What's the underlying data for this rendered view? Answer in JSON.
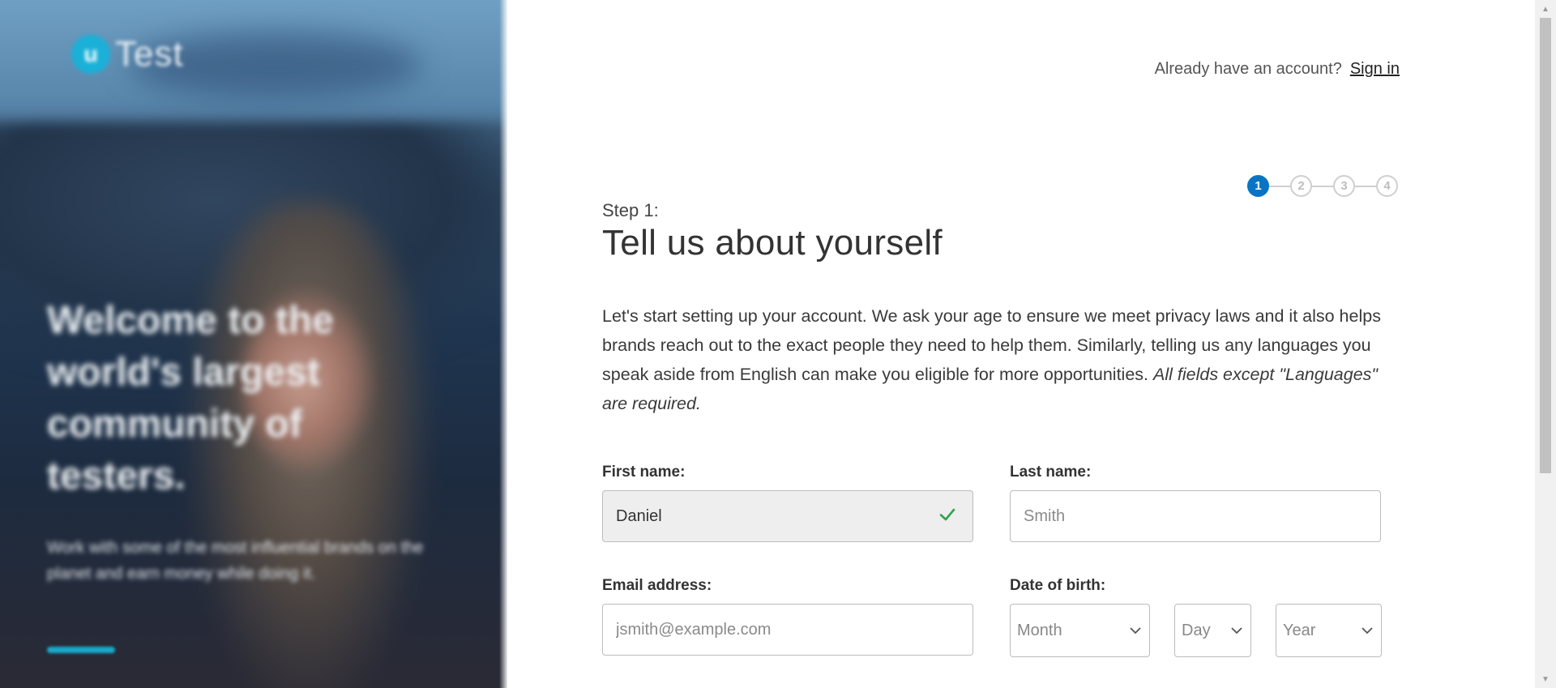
{
  "hero": {
    "logo_mark": "u",
    "logo_text": "Test",
    "headline": "Welcome to the world's largest community of testers.",
    "subcopy": "Work with some of the most influential brands on the planet and earn money while doing it."
  },
  "header": {
    "prompt": "Already have an account?",
    "signin_label": "Sign in"
  },
  "stepper": {
    "steps": [
      "1",
      "2",
      "3",
      "4"
    ],
    "active": 1
  },
  "form": {
    "step_label": "Step 1:",
    "title": "Tell us about yourself",
    "intro": "Let's start setting up your account. We ask your age to ensure we meet privacy laws and it also helps brands reach out to the exact people they need to help them. Similarly, telling us any languages you speak aside from English can make you eligible for more opportunities.",
    "intro_note": "All fields except \"Languages\" are required.",
    "first_name": {
      "label": "First name:",
      "value": "Daniel"
    },
    "last_name": {
      "label": "Last name:",
      "placeholder": "Smith"
    },
    "email": {
      "label": "Email address:",
      "placeholder": "jsmith@example.com"
    },
    "dob": {
      "label": "Date of birth:",
      "month": "Month",
      "day": "Day",
      "year": "Year"
    }
  },
  "colors": {
    "accent": "#0a74c4",
    "valid": "#2ea34b",
    "hero_accent": "#1aa9c9"
  }
}
